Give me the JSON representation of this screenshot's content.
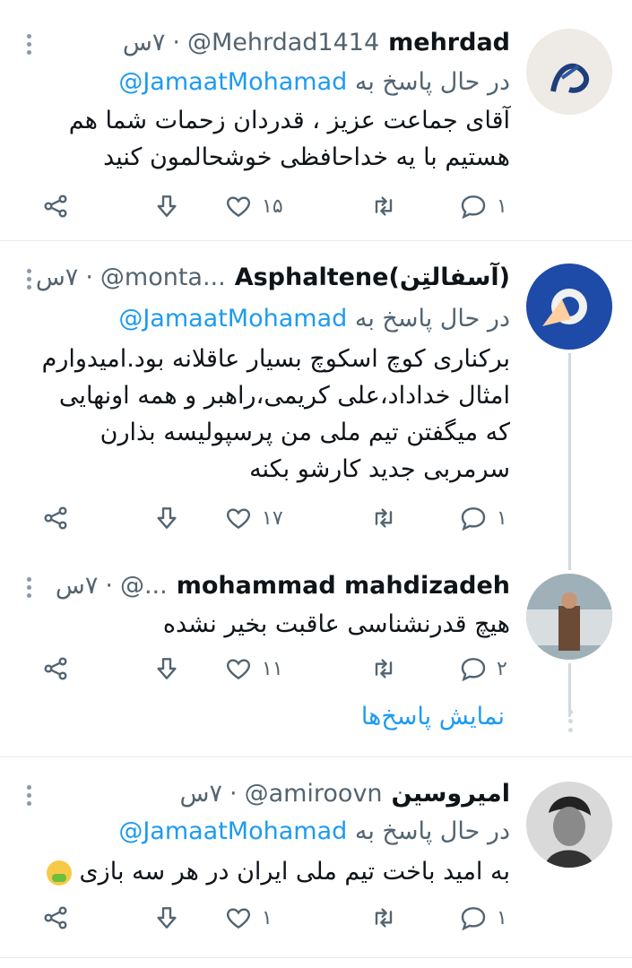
{
  "tweets": [
    {
      "name": "mehrdad",
      "handle": "@Mehrdad1414",
      "time": "۷س",
      "reply_label": "در حال پاسخ به",
      "reply_mention": "@JamaatMohamad",
      "body": "آقای جماعت عزیز ، قدردان زحمات شما هم هستیم با یه خداحافظی خوشحالمون کنید",
      "replies": "۱",
      "likes": "۱۵",
      "retweets": ""
    },
    {
      "name": "Asphaltene(آسفالتِن)",
      "handle": "@monta...",
      "time": "۷س",
      "reply_label": "در حال پاسخ به",
      "reply_mention": "@JamaatMohamad",
      "body": "برکناری کوچ اسکوچ بسیار عاقلانه بود.امیدوارم امثال خداداد،علی کریمی،راهبر و همه اونهایی که میگفتن تیم ملی من پرسپولیسه بذارن سرمربی جدید کارشو بکنه",
      "replies": "۱",
      "likes": "۱۷",
      "retweets": ""
    },
    {
      "name": "mohammad mahdizadeh",
      "handle": "@...",
      "time": "۷س",
      "body": "هیچ قدرنشناسی عاقبت بخیر نشده",
      "replies": "۲",
      "likes": "۱۱",
      "retweets": ""
    },
    {
      "name": "امیرو‌ﺳﻴﻦ",
      "handle": "@amiroovn",
      "time": "۷س",
      "reply_label": "در حال پاسخ به",
      "reply_mention": "@JamaatMohamad",
      "body": "به امید باخت تیم ملی ایران در هر سه بازی",
      "replies": "۱",
      "likes": "۱",
      "retweets": ""
    }
  ],
  "show_replies": "نمایش پاسخ‌ها",
  "icons": [
    "more-icon",
    "reply-icon",
    "retweet-icon",
    "like-icon",
    "downvote-icon",
    "share-icon",
    "nauseated-emoji"
  ],
  "colors": {
    "accent": "#1d9bf0",
    "muted": "#536471",
    "text": "#0f1419"
  }
}
